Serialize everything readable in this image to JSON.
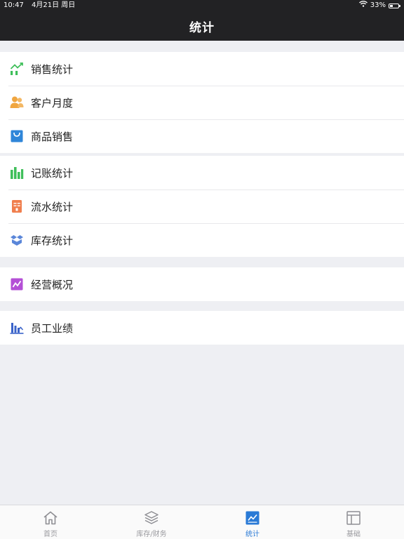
{
  "status_bar": {
    "time": "10:47",
    "date": "4月21日 周日",
    "battery_percent": "33%",
    "battery_level": 0.33
  },
  "nav": {
    "title": "统计"
  },
  "groups": [
    {
      "items": [
        {
          "label": "销售统计",
          "icon": "trend-line-icon",
          "color": "#3fbf5a"
        },
        {
          "label": "客户月度",
          "icon": "customers-icon",
          "color": "#f0a640"
        },
        {
          "label": "商品销售",
          "icon": "shopping-bag-icon",
          "color": "#2f86d9"
        }
      ]
    },
    {
      "items": [
        {
          "label": "记账统计",
          "icon": "bar-chart-icon",
          "color": "#3fbf5a"
        },
        {
          "label": "流水统计",
          "icon": "receipt-icon",
          "color": "#f07f4e"
        },
        {
          "label": "库存统计",
          "icon": "box-icon",
          "color": "#5a86d9"
        }
      ]
    },
    {
      "items": [
        {
          "label": "经营概况",
          "icon": "overview-chart-icon",
          "color": "#b44fd6"
        }
      ]
    },
    {
      "items": [
        {
          "label": "员工业绩",
          "icon": "performance-icon",
          "color": "#3a63c9"
        }
      ]
    }
  ],
  "tabbar": {
    "tabs": [
      {
        "label": "首页",
        "icon": "home-icon",
        "active": false
      },
      {
        "label": "库存/财务",
        "icon": "layers-icon",
        "active": false
      },
      {
        "label": "统计",
        "icon": "stats-icon",
        "active": true
      },
      {
        "label": "基础",
        "icon": "layout-icon",
        "active": false
      }
    ],
    "active_color": "#2a7ad6",
    "inactive_color": "#9a9a9f"
  }
}
